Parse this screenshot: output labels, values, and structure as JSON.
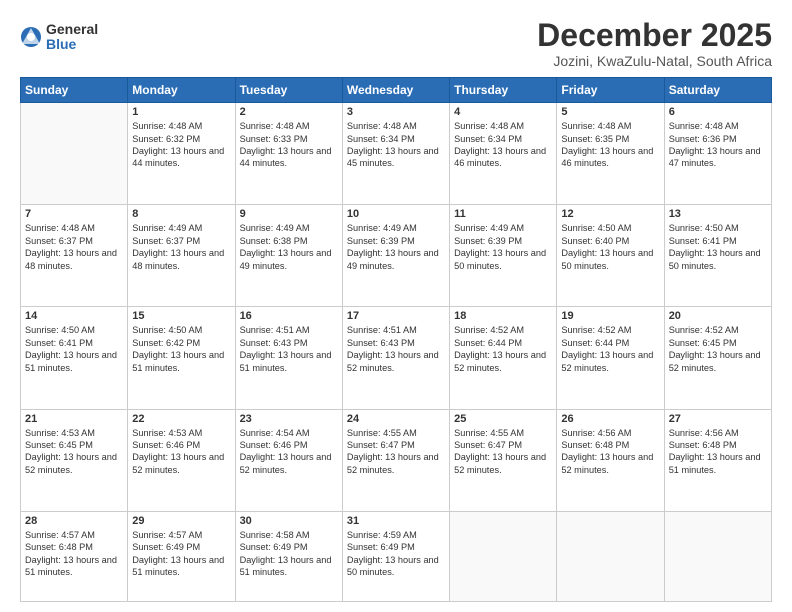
{
  "header": {
    "logo_general": "General",
    "logo_blue": "Blue",
    "month_title": "December 2025",
    "subtitle": "Jozini, KwaZulu-Natal, South Africa"
  },
  "days_of_week": [
    "Sunday",
    "Monday",
    "Tuesday",
    "Wednesday",
    "Thursday",
    "Friday",
    "Saturday"
  ],
  "weeks": [
    [
      {
        "day": "",
        "sunrise": "",
        "sunset": "",
        "daylight": ""
      },
      {
        "day": "1",
        "sunrise": "Sunrise: 4:48 AM",
        "sunset": "Sunset: 6:32 PM",
        "daylight": "Daylight: 13 hours and 44 minutes."
      },
      {
        "day": "2",
        "sunrise": "Sunrise: 4:48 AM",
        "sunset": "Sunset: 6:33 PM",
        "daylight": "Daylight: 13 hours and 44 minutes."
      },
      {
        "day": "3",
        "sunrise": "Sunrise: 4:48 AM",
        "sunset": "Sunset: 6:34 PM",
        "daylight": "Daylight: 13 hours and 45 minutes."
      },
      {
        "day": "4",
        "sunrise": "Sunrise: 4:48 AM",
        "sunset": "Sunset: 6:34 PM",
        "daylight": "Daylight: 13 hours and 46 minutes."
      },
      {
        "day": "5",
        "sunrise": "Sunrise: 4:48 AM",
        "sunset": "Sunset: 6:35 PM",
        "daylight": "Daylight: 13 hours and 46 minutes."
      },
      {
        "day": "6",
        "sunrise": "Sunrise: 4:48 AM",
        "sunset": "Sunset: 6:36 PM",
        "daylight": "Daylight: 13 hours and 47 minutes."
      }
    ],
    [
      {
        "day": "7",
        "sunrise": "Sunrise: 4:48 AM",
        "sunset": "Sunset: 6:37 PM",
        "daylight": "Daylight: 13 hours and 48 minutes."
      },
      {
        "day": "8",
        "sunrise": "Sunrise: 4:49 AM",
        "sunset": "Sunset: 6:37 PM",
        "daylight": "Daylight: 13 hours and 48 minutes."
      },
      {
        "day": "9",
        "sunrise": "Sunrise: 4:49 AM",
        "sunset": "Sunset: 6:38 PM",
        "daylight": "Daylight: 13 hours and 49 minutes."
      },
      {
        "day": "10",
        "sunrise": "Sunrise: 4:49 AM",
        "sunset": "Sunset: 6:39 PM",
        "daylight": "Daylight: 13 hours and 49 minutes."
      },
      {
        "day": "11",
        "sunrise": "Sunrise: 4:49 AM",
        "sunset": "Sunset: 6:39 PM",
        "daylight": "Daylight: 13 hours and 50 minutes."
      },
      {
        "day": "12",
        "sunrise": "Sunrise: 4:50 AM",
        "sunset": "Sunset: 6:40 PM",
        "daylight": "Daylight: 13 hours and 50 minutes."
      },
      {
        "day": "13",
        "sunrise": "Sunrise: 4:50 AM",
        "sunset": "Sunset: 6:41 PM",
        "daylight": "Daylight: 13 hours and 50 minutes."
      }
    ],
    [
      {
        "day": "14",
        "sunrise": "Sunrise: 4:50 AM",
        "sunset": "Sunset: 6:41 PM",
        "daylight": "Daylight: 13 hours and 51 minutes."
      },
      {
        "day": "15",
        "sunrise": "Sunrise: 4:50 AM",
        "sunset": "Sunset: 6:42 PM",
        "daylight": "Daylight: 13 hours and 51 minutes."
      },
      {
        "day": "16",
        "sunrise": "Sunrise: 4:51 AM",
        "sunset": "Sunset: 6:43 PM",
        "daylight": "Daylight: 13 hours and 51 minutes."
      },
      {
        "day": "17",
        "sunrise": "Sunrise: 4:51 AM",
        "sunset": "Sunset: 6:43 PM",
        "daylight": "Daylight: 13 hours and 52 minutes."
      },
      {
        "day": "18",
        "sunrise": "Sunrise: 4:52 AM",
        "sunset": "Sunset: 6:44 PM",
        "daylight": "Daylight: 13 hours and 52 minutes."
      },
      {
        "day": "19",
        "sunrise": "Sunrise: 4:52 AM",
        "sunset": "Sunset: 6:44 PM",
        "daylight": "Daylight: 13 hours and 52 minutes."
      },
      {
        "day": "20",
        "sunrise": "Sunrise: 4:52 AM",
        "sunset": "Sunset: 6:45 PM",
        "daylight": "Daylight: 13 hours and 52 minutes."
      }
    ],
    [
      {
        "day": "21",
        "sunrise": "Sunrise: 4:53 AM",
        "sunset": "Sunset: 6:45 PM",
        "daylight": "Daylight: 13 hours and 52 minutes."
      },
      {
        "day": "22",
        "sunrise": "Sunrise: 4:53 AM",
        "sunset": "Sunset: 6:46 PM",
        "daylight": "Daylight: 13 hours and 52 minutes."
      },
      {
        "day": "23",
        "sunrise": "Sunrise: 4:54 AM",
        "sunset": "Sunset: 6:46 PM",
        "daylight": "Daylight: 13 hours and 52 minutes."
      },
      {
        "day": "24",
        "sunrise": "Sunrise: 4:55 AM",
        "sunset": "Sunset: 6:47 PM",
        "daylight": "Daylight: 13 hours and 52 minutes."
      },
      {
        "day": "25",
        "sunrise": "Sunrise: 4:55 AM",
        "sunset": "Sunset: 6:47 PM",
        "daylight": "Daylight: 13 hours and 52 minutes."
      },
      {
        "day": "26",
        "sunrise": "Sunrise: 4:56 AM",
        "sunset": "Sunset: 6:48 PM",
        "daylight": "Daylight: 13 hours and 52 minutes."
      },
      {
        "day": "27",
        "sunrise": "Sunrise: 4:56 AM",
        "sunset": "Sunset: 6:48 PM",
        "daylight": "Daylight: 13 hours and 51 minutes."
      }
    ],
    [
      {
        "day": "28",
        "sunrise": "Sunrise: 4:57 AM",
        "sunset": "Sunset: 6:48 PM",
        "daylight": "Daylight: 13 hours and 51 minutes."
      },
      {
        "day": "29",
        "sunrise": "Sunrise: 4:57 AM",
        "sunset": "Sunset: 6:49 PM",
        "daylight": "Daylight: 13 hours and 51 minutes."
      },
      {
        "day": "30",
        "sunrise": "Sunrise: 4:58 AM",
        "sunset": "Sunset: 6:49 PM",
        "daylight": "Daylight: 13 hours and 51 minutes."
      },
      {
        "day": "31",
        "sunrise": "Sunrise: 4:59 AM",
        "sunset": "Sunset: 6:49 PM",
        "daylight": "Daylight: 13 hours and 50 minutes."
      },
      {
        "day": "",
        "sunrise": "",
        "sunset": "",
        "daylight": ""
      },
      {
        "day": "",
        "sunrise": "",
        "sunset": "",
        "daylight": ""
      },
      {
        "day": "",
        "sunrise": "",
        "sunset": "",
        "daylight": ""
      }
    ]
  ]
}
